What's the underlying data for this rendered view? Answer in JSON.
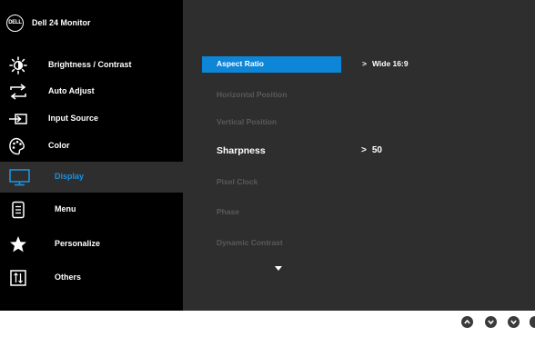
{
  "header": {
    "logo_text": "DELL",
    "title": "Dell 24 Monitor"
  },
  "sidebar": {
    "items": [
      {
        "label": "Brightness / Contrast"
      },
      {
        "label": "Auto Adjust"
      },
      {
        "label": "Input Source"
      },
      {
        "label": "Color"
      },
      {
        "label": "Display"
      },
      {
        "label": "Menu"
      },
      {
        "label": "Personalize"
      },
      {
        "label": "Others"
      }
    ]
  },
  "display_menu": {
    "options": [
      {
        "label": "Aspect Ratio",
        "value": "Wide 16:9"
      },
      {
        "label": "Horizontal Position"
      },
      {
        "label": "Vertical Position"
      },
      {
        "label": "Sharpness",
        "value": "50"
      },
      {
        "label": "Pixel Clock"
      },
      {
        "label": "Phase"
      },
      {
        "label": "Dynamic Contrast"
      }
    ],
    "value_prefix": ">"
  },
  "colors": {
    "accent": "#0d86d8",
    "active_label": "#1f8fdc"
  }
}
